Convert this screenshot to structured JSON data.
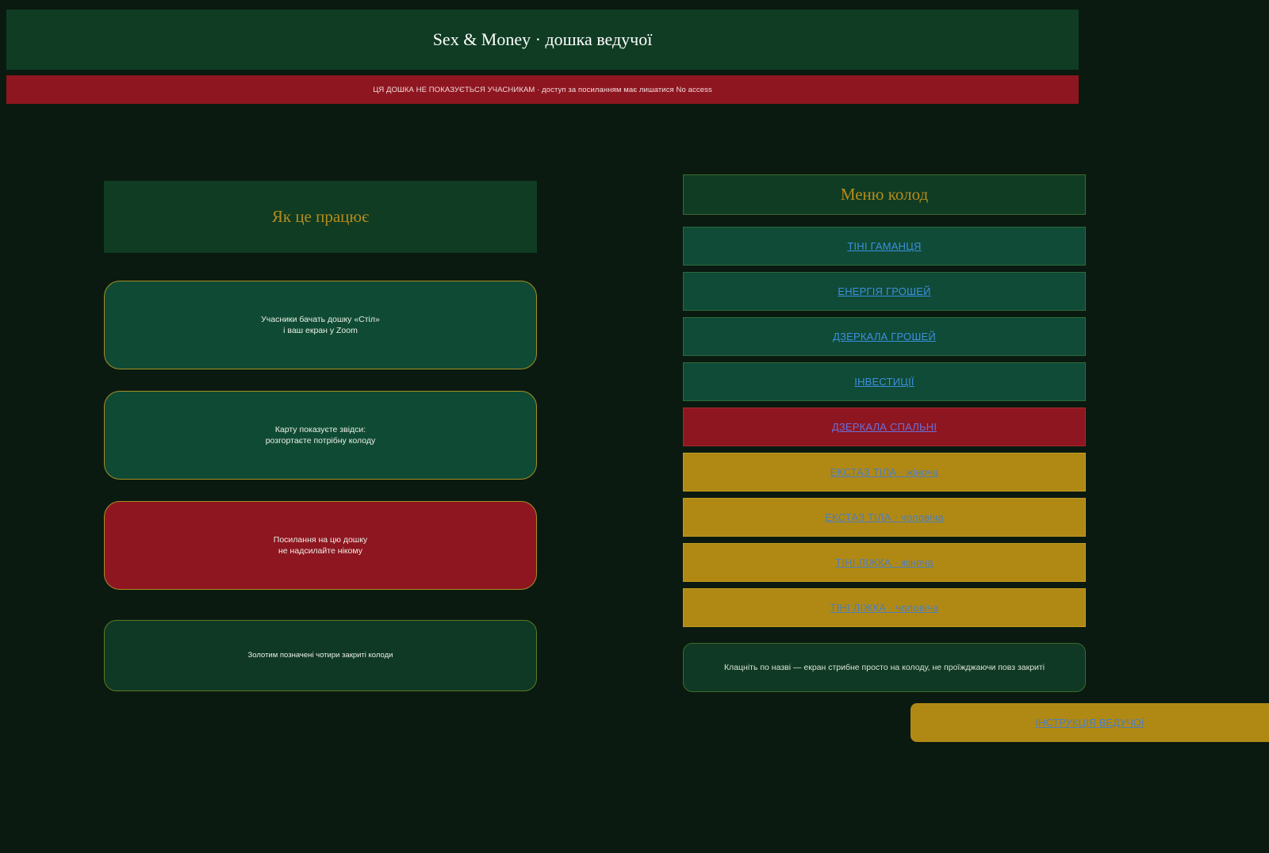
{
  "header": {
    "title": "Sex & Money · дошка ведучої",
    "warning": "ЦЯ ДОШКА НЕ ПОКАЗУЄТЬСЯ УЧАСНИКАМ · доступ за посиланням має лишатися No access"
  },
  "how_it_works": {
    "title": "Як це працює",
    "cards": [
      {
        "line1": "Учасники бачать дошку «Стіл»",
        "line2": "і ваш екран у Zoom"
      },
      {
        "line1": "Карту показуєте звідси:",
        "line2": "розгортаєте потрібну колоду"
      },
      {
        "line1": "Посилання на цю дошку",
        "line2": "не надсилайте нікому"
      },
      {
        "line1": "Золотим позначені чотири закриті колоди"
      }
    ]
  },
  "deck_menu": {
    "title": "Меню колод",
    "decks": [
      {
        "label": "ТІНІ ГАМАНЦЯ",
        "color": "green"
      },
      {
        "label": "ЕНЕРГІЯ ГРОШЕЙ",
        "color": "green"
      },
      {
        "label": "ДЗЕРКАЛА ГРОШЕЙ",
        "color": "green"
      },
      {
        "label": "ІНВЕСТИЦІЇ",
        "color": "green"
      },
      {
        "label": "ДЗЕРКАЛА СПАЛЬНІ",
        "color": "red"
      },
      {
        "label": "ЕКСТАЗ ТІЛА · жіноча",
        "color": "gold"
      },
      {
        "label": "ЕКСТАЗ ТІЛА · чоловіча",
        "color": "gold"
      },
      {
        "label": "ТІНІ ЛІЖКА · жіноча",
        "color": "gold"
      },
      {
        "label": "ТІНІ ЛІЖКА · чоловіча",
        "color": "gold"
      }
    ],
    "hint": "Клацніть по назві — екран стрибне просто на колоду, не проїжджаючи повз закриті"
  },
  "guide_button": {
    "label": "ІНСТРУКЦІЯ ВЕДУЧОЇ"
  },
  "colors": {
    "background": "#0a1a10",
    "green": "#0f4b34",
    "red": "#8e1620",
    "gold": "#b08915",
    "title_gold": "#b68b1c",
    "link_blue": "#3d8fe0"
  }
}
